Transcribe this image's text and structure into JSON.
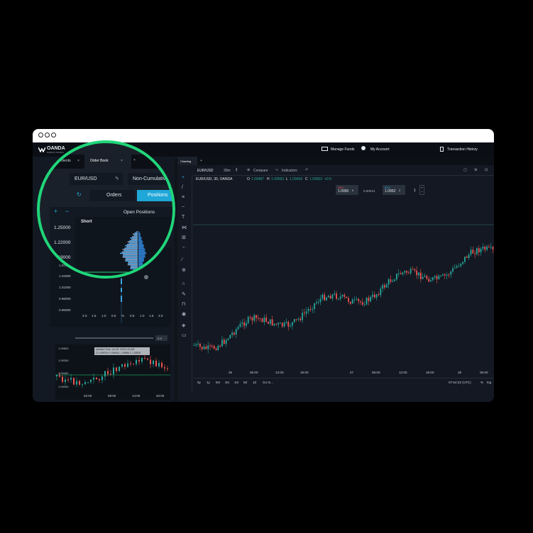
{
  "nav": {
    "logo": "OANDA",
    "logo_sub": "MARKETS TRADING",
    "manage_funds": "Manage Funds",
    "my_account": "My Account:",
    "transaction_history": "Transaction History"
  },
  "left_tabs": {
    "instruments": "ments",
    "order_book": "Order Book"
  },
  "orderbook": {
    "instrument": "EUR/USD",
    "mode": "Non-Cumulative",
    "tab_orders": "Orders",
    "tab_positions": "Positions",
    "section_title": "Open Positions",
    "short_label": "Short",
    "price_levels_zoom": [
      "1.25000",
      "1.22000",
      "1.19000"
    ],
    "price_levels": [
      "1.07000",
      "1.04000",
      "1.01000",
      "0.98000",
      "0.95000"
    ],
    "x_axis": [
      "2.0",
      "1.5",
      "1.0",
      "0.5",
      "%",
      "0.5",
      "1.0",
      "1.5",
      "2.0"
    ],
    "slider_label": "0 H"
  },
  "mini_chart": {
    "y_labels": [
      "1.09600",
      "1.09200",
      "1.09400",
      "1.09200"
    ],
    "x_labels": [
      "02:00",
      "08:00",
      "14:00",
      "20:00"
    ],
    "tooltip_line1": "Updated Time: Jun 29, 2023 0:40 AM",
    "tooltip_line2": "O 1.09578  H 1.09606  L 1.09566  C 1.09578"
  },
  "chart_tabs": {
    "charting": "Charting"
  },
  "chart_toolbar": {
    "symbol": "EUR/USD",
    "interval": "30m",
    "compare": "Compare",
    "indicators": "Indicators"
  },
  "legend": {
    "title": "EUR/USD, 30, OANDA",
    "o_label": "O",
    "o": "1.09487",
    "h_label": "H",
    "h": "1.09563",
    "l_label": "L",
    "l": "1.09469",
    "c_label": "C",
    "c": "1.09503",
    "change": "+0.0"
  },
  "trade": {
    "sell_label": "SELL",
    "sell_price": "1.0950",
    "sell_sup": "0",
    "spread": "0.00014",
    "buy_label": "BUY",
    "buy_price": "1.0952",
    "buy_sup": "2",
    "qty": "1"
  },
  "chart_x_labels": [
    "25",
    "06:00",
    "12:00",
    "18:00",
    "27",
    "06:00",
    "12:00",
    "18:00",
    "28",
    "06:00",
    "12:00"
  ],
  "ranges": [
    "5y",
    "1y",
    "6m",
    "3m",
    "1m",
    "5d",
    "1d"
  ],
  "goto": "Go to...",
  "time_display": "07:54:32 (UTC)",
  "scale_opts": [
    "%",
    "log"
  ],
  "colors": {
    "up": "#26a69a",
    "down": "#ef5350",
    "accent": "#1fa7d8",
    "ring": "#20d67a"
  }
}
